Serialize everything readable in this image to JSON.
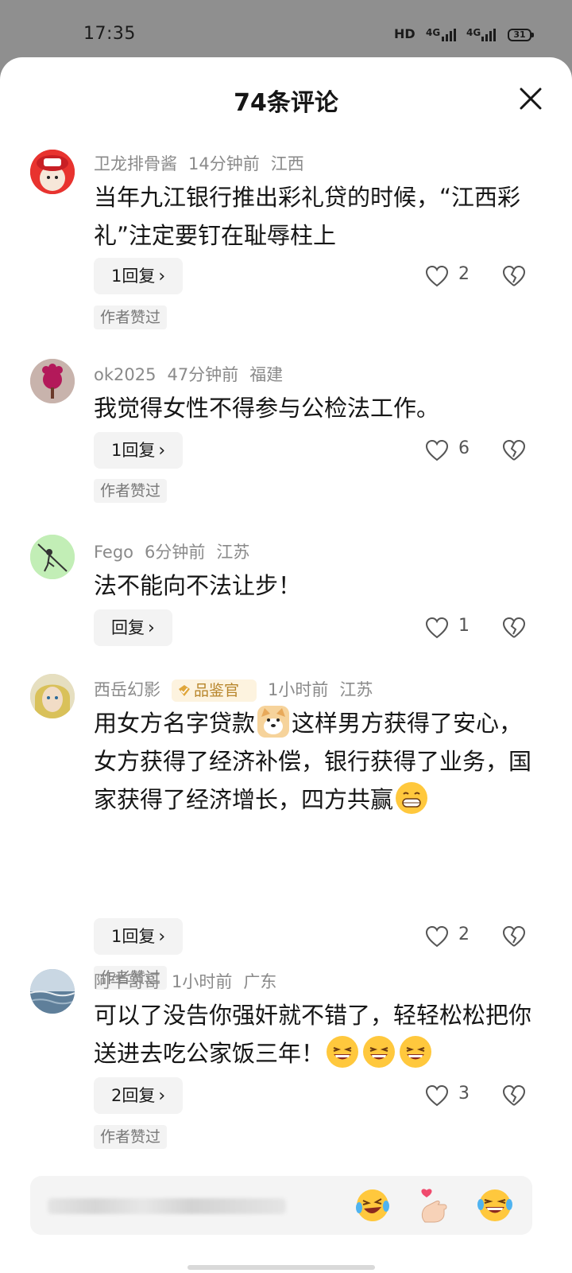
{
  "status_bar": {
    "time": "17:35",
    "hd": "HD",
    "signal1": "4G",
    "signal2": "4G",
    "battery": "31"
  },
  "header": {
    "title": "74条评论"
  },
  "comments": [
    {
      "username": "卫龙排骨酱",
      "time": "14分钟前",
      "location": "江西",
      "text": "当年九江银行推出彩礼贷的时候，“江西彩礼”注定要钉在耻辱柱上",
      "reply_label": "1回复",
      "likes": "2",
      "author_liked": "作者赞过"
    },
    {
      "username": "ok2025",
      "time": "47分钟前",
      "location": "福建",
      "text": "我觉得女性不得参与公检法工作。",
      "reply_label": "1回复",
      "likes": "6",
      "author_liked": "作者赞过"
    },
    {
      "username": "Fego",
      "time": "6分钟前",
      "location": "江苏",
      "text": "法不能向不法让步！",
      "reply_label": "回复",
      "likes": "1"
    },
    {
      "username": "西岳幻影",
      "badge": "品鉴官",
      "time": "1小时前",
      "location": "江苏",
      "text_a": "用女方名字贷款",
      "text_b": "这样男方获得了安心，女方获得了经济补偿，银行获得了业务，国家获得了经济增长，四方共赢",
      "reply_label": "1回复",
      "likes": "2",
      "author_liked": "作者赞过"
    },
    {
      "username": "阿牛哥哥",
      "time": "1小时前",
      "location": "广东",
      "text": "可以了没告你强奸就不错了，轻轻松松把你送进去吃公家饭三年！",
      "reply_label": "2回复",
      "likes": "3",
      "author_liked": "作者赞过"
    }
  ],
  "quick_emojis": [
    "crying-laughing-emoji",
    "finger-heart-emoji",
    "rolling-laughing-emoji"
  ],
  "colors": {
    "badge_gold": "#b8862c",
    "muted_text": "#8a8a8a",
    "button_bg": "#f3f3f3"
  }
}
